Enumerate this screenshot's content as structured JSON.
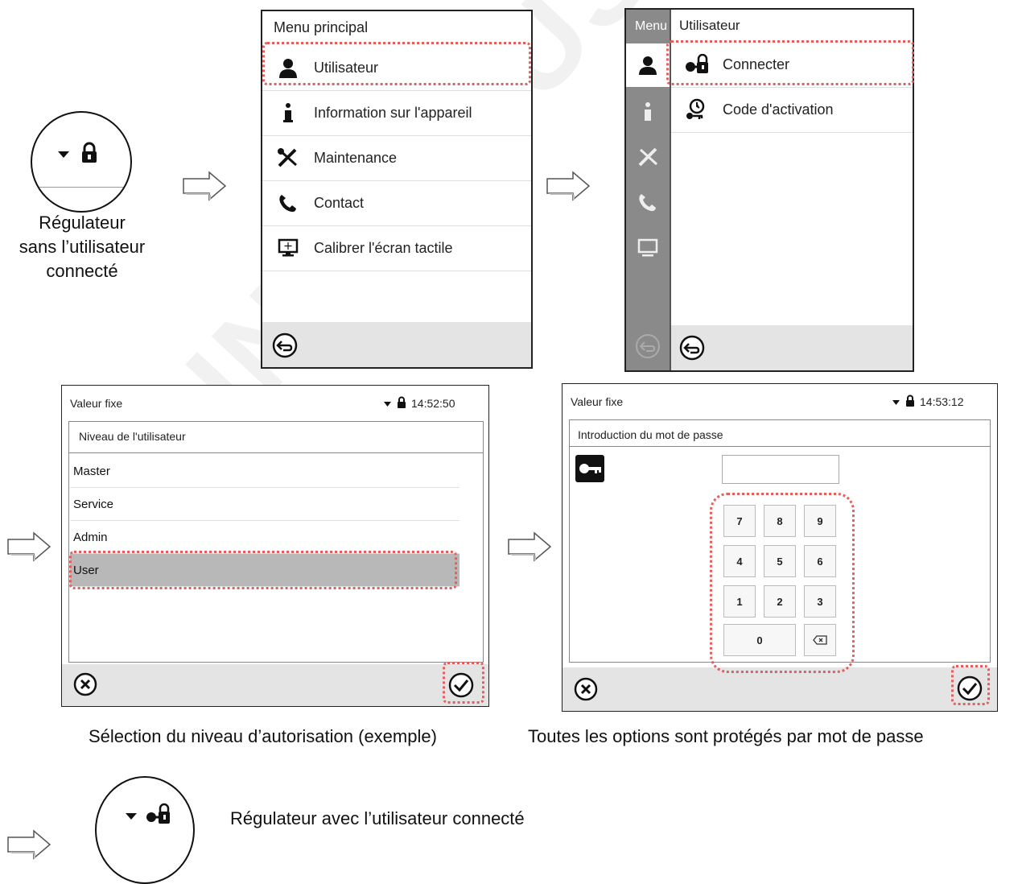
{
  "captions": {
    "no_user": [
      "Régulateur",
      "sans l’utilisateur",
      "connecté"
    ],
    "select_level": "Sélection du niveau d’autorisation (exemple)",
    "password": "Toutes les options sont protégés par mot de passe",
    "with_user": "Régulateur avec l’utilisateur connecté"
  },
  "main_menu": {
    "title": "Menu principal",
    "items": [
      {
        "label": "Utilisateur",
        "icon": "user-icon"
      },
      {
        "label": "Information sur l'appareil",
        "icon": "info-icon"
      },
      {
        "label": "Maintenance",
        "icon": "tools-icon"
      },
      {
        "label": "Contact",
        "icon": "phone-icon"
      },
      {
        "label": "Calibrer l'écran tactile",
        "icon": "monitor-icon"
      }
    ]
  },
  "user_menu": {
    "side_title": "Menu",
    "title": "Utilisateur",
    "items": [
      {
        "label": "Connecter",
        "icon": "login-lock-icon"
      },
      {
        "label": "Code d'activation",
        "icon": "activation-key-icon"
      }
    ]
  },
  "level_screen": {
    "title": "Valeur fixe",
    "time": "14:52:50",
    "header": "Niveau de l'utilisateur",
    "options": [
      "Master",
      "Service",
      "Admin",
      "User"
    ],
    "selected": "User"
  },
  "password_screen": {
    "title": "Valeur fixe",
    "time": "14:53:12",
    "header": "Introduction du mot de passe",
    "keys": [
      "7",
      "8",
      "9",
      "4",
      "5",
      "6",
      "1",
      "2",
      "3",
      "0"
    ],
    "backspace_icon": "backspace-icon"
  },
  "watermark": "BINDER USER DUTSCHER SAS",
  "colors": {
    "highlight": "#e06060",
    "selected_row": "#b8b8b8",
    "footer": "#e4e4e4",
    "sidebar": "#8a8a8a"
  }
}
